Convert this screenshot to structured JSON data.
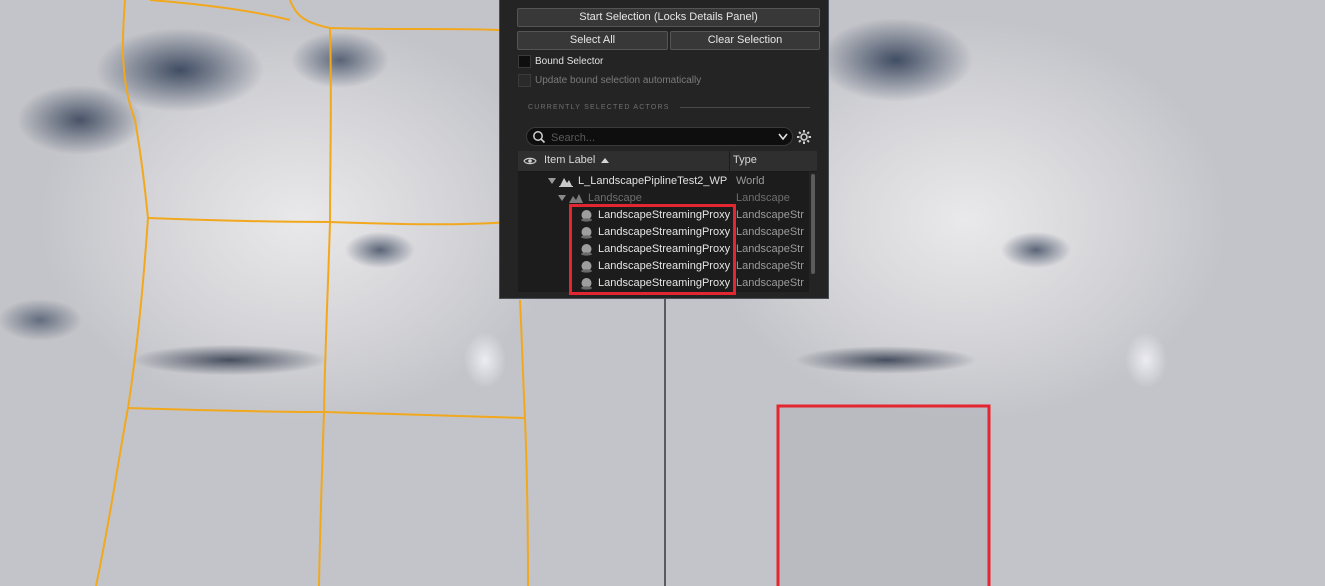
{
  "viewports": {
    "left_label": "",
    "right_label": ""
  },
  "panel": {
    "start_selection_label": "Start Selection (Locks Details Panel)",
    "select_all_label": "Select All",
    "clear_selection_label": "Clear Selection",
    "bound_selector_label": "Bound Selector",
    "update_bound_label": "Update bound selection automatically",
    "section_title": "CURRENTLY SELECTED ACTORS",
    "search": {
      "placeholder": "Search..."
    },
    "columns": {
      "item_label": "Item Label",
      "type": "Type"
    },
    "rows": [
      {
        "name": "L_LandscapePiplineTest2_WP",
        "type": "World",
        "icon": "world-icon",
        "dim": false
      },
      {
        "name": "Landscape",
        "type": "Landscape",
        "icon": "landscape-icon",
        "dim": true
      },
      {
        "name": "LandscapeStreamingProxy",
        "type": "LandscapeStr",
        "icon": "actor-sphere-icon",
        "dim": false
      },
      {
        "name": "LandscapeStreamingProxy",
        "type": "LandscapeStr",
        "icon": "actor-sphere-icon",
        "dim": false
      },
      {
        "name": "LandscapeStreamingProxy",
        "type": "LandscapeStr",
        "icon": "actor-sphere-icon",
        "dim": false
      },
      {
        "name": "LandscapeStreamingProxy",
        "type": "LandscapeStr",
        "icon": "actor-sphere-icon",
        "dim": false
      },
      {
        "name": "LandscapeStreamingProxy",
        "type": "LandscapeStr",
        "icon": "actor-sphere-icon",
        "dim": false
      }
    ]
  },
  "colors": {
    "grid_line": "#f2a81d",
    "highlight": "#e3262f",
    "panel_bg": "#242424"
  }
}
